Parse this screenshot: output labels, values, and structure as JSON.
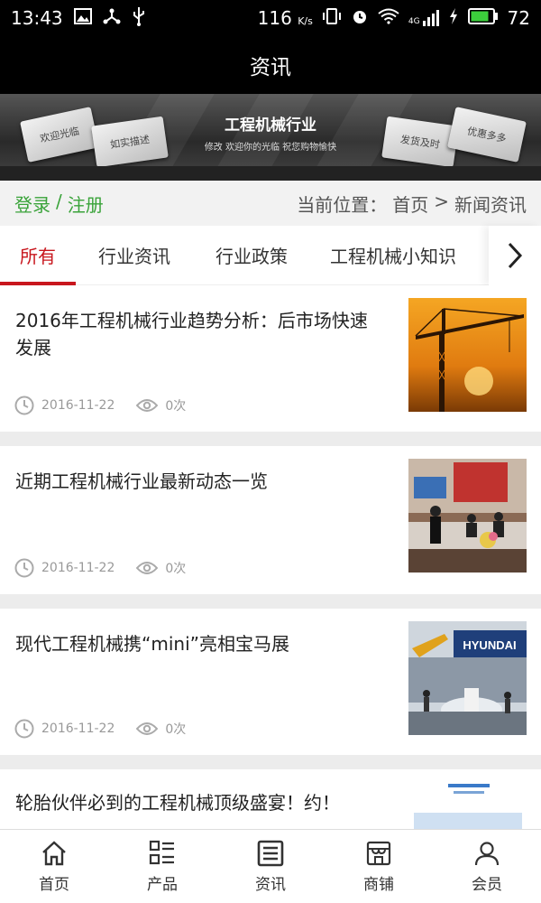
{
  "status_bar": {
    "time": "13:43",
    "speed": "116",
    "speed_unit": "K/s",
    "network": "4G",
    "battery": "72"
  },
  "header": {
    "title": "资讯"
  },
  "banner": {
    "title": "工程机械行业",
    "subtitle": "修改 欢迎你的光临 祝您购物愉快",
    "cards": [
      "欢迎光临",
      "如实描述",
      "发货及时",
      "优惠多多"
    ]
  },
  "account": {
    "login": "登录",
    "separator": "/",
    "register": "注册"
  },
  "breadcrumb": {
    "prefix": "当前位置：",
    "home": "首页",
    "sep": ">",
    "current": "新闻资讯"
  },
  "tabs": [
    "所有",
    "行业资讯",
    "行业政策",
    "工程机械小知识"
  ],
  "articles": [
    {
      "title": "2016年工程机械行业趋势分析：后市场快速发展",
      "date": "2016-11-22",
      "views": "0次",
      "image": "tower-crane-sunset"
    },
    {
      "title": "近期工程机械行业最新动态一览",
      "date": "2016-11-22",
      "views": "0次",
      "image": "signing-ceremony"
    },
    {
      "title": "现代工程机械携“mini”亮相宝马展",
      "date": "2016-11-22",
      "views": "0次",
      "image": "hyundai-exhibition"
    },
    {
      "title": "轮胎伙伴必到的工程机械顶级盛宴！约！",
      "date": "",
      "views": "",
      "image": "event-poster"
    }
  ],
  "bottom_nav": [
    "首页",
    "产品",
    "资讯",
    "商铺",
    "会员"
  ],
  "colors": {
    "accent": "#c8161d",
    "login_green": "#3aa33a",
    "bar": "#000000"
  }
}
